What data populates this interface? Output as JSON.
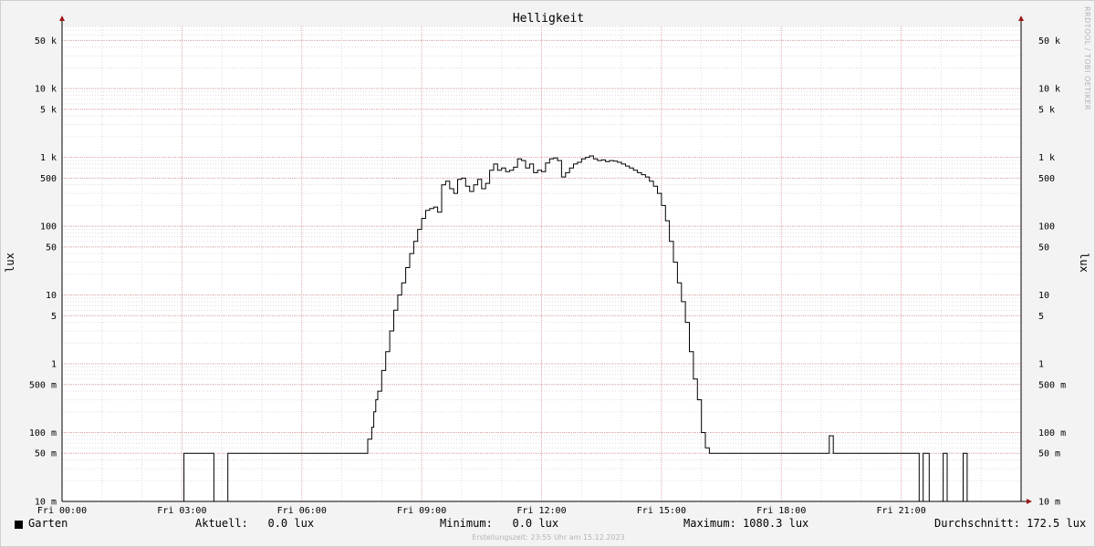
{
  "chart_data": {
    "type": "line",
    "title": "Helligkeit",
    "ylabel": "lux",
    "yscale": "log",
    "ylim": [
      0.01,
      80000
    ],
    "xlim": [
      0,
      24
    ],
    "grid": true,
    "y_ticks": [
      {
        "value": 0.01,
        "label": "10 m"
      },
      {
        "value": 0.05,
        "label": "50 m"
      },
      {
        "value": 0.1,
        "label": "100 m"
      },
      {
        "value": 0.5,
        "label": "500 m"
      },
      {
        "value": 1,
        "label": "1"
      },
      {
        "value": 5,
        "label": "5"
      },
      {
        "value": 10,
        "label": "10"
      },
      {
        "value": 50,
        "label": "50"
      },
      {
        "value": 100,
        "label": "100"
      },
      {
        "value": 500,
        "label": "500"
      },
      {
        "value": 1000,
        "label": "1 k"
      },
      {
        "value": 5000,
        "label": "5 k"
      },
      {
        "value": 10000,
        "label": "10 k"
      },
      {
        "value": 50000,
        "label": "50 k"
      }
    ],
    "x_ticks": [
      {
        "value": 0,
        "label": "Fri 00:00"
      },
      {
        "value": 3,
        "label": "Fri 03:00"
      },
      {
        "value": 6,
        "label": "Fri 06:00"
      },
      {
        "value": 9,
        "label": "Fri 09:00"
      },
      {
        "value": 12,
        "label": "Fri 12:00"
      },
      {
        "value": 15,
        "label": "Fri 15:00"
      },
      {
        "value": 18,
        "label": "Fri 18:00"
      },
      {
        "value": 21,
        "label": "Fri 21:00"
      }
    ],
    "series": [
      {
        "name": "Garten",
        "color": "#000000",
        "x": [
          0,
          3.0,
          3.05,
          3.75,
          3.8,
          4.1,
          4.15,
          4.2,
          7.6,
          7.65,
          7.75,
          7.8,
          7.85,
          7.9,
          8.0,
          8.1,
          8.2,
          8.3,
          8.4,
          8.5,
          8.6,
          8.7,
          8.8,
          8.9,
          9.0,
          9.1,
          9.2,
          9.3,
          9.4,
          9.5,
          9.6,
          9.7,
          9.8,
          9.9,
          10.0,
          10.1,
          10.2,
          10.3,
          10.4,
          10.5,
          10.6,
          10.7,
          10.8,
          10.9,
          11.0,
          11.1,
          11.2,
          11.3,
          11.4,
          11.5,
          11.6,
          11.7,
          11.8,
          11.9,
          12.0,
          12.1,
          12.2,
          12.3,
          12.4,
          12.5,
          12.6,
          12.7,
          12.8,
          12.9,
          13.0,
          13.1,
          13.2,
          13.3,
          13.4,
          13.5,
          13.6,
          13.7,
          13.8,
          13.9,
          14.0,
          14.1,
          14.2,
          14.3,
          14.4,
          14.5,
          14.6,
          14.7,
          14.8,
          14.9,
          15.0,
          15.1,
          15.2,
          15.3,
          15.4,
          15.5,
          15.6,
          15.7,
          15.8,
          15.9,
          16.0,
          16.1,
          16.2,
          16.3,
          16.4,
          16.5,
          16.6,
          16.7,
          16.8,
          16.9,
          17.0,
          17.1,
          17.2,
          17.25,
          19.15,
          19.2,
          19.25,
          19.3,
          21.4,
          21.45,
          21.55,
          21.6,
          21.7,
          21.75,
          22.0,
          22.05,
          22.1,
          22.15,
          22.5,
          22.55,
          22.6,
          22.65,
          24
        ],
        "y": [
          0.01,
          0.01,
          0.05,
          0.05,
          0.01,
          0.01,
          0.05,
          0.05,
          0.05,
          0.08,
          0.12,
          0.2,
          0.3,
          0.4,
          0.8,
          1.5,
          3,
          6,
          10,
          15,
          25,
          40,
          60,
          90,
          130,
          170,
          180,
          190,
          160,
          400,
          450,
          350,
          300,
          480,
          500,
          380,
          320,
          400,
          480,
          350,
          420,
          650,
          800,
          650,
          700,
          620,
          650,
          720,
          950,
          900,
          700,
          800,
          600,
          650,
          620,
          830,
          950,
          980,
          900,
          520,
          600,
          700,
          800,
          850,
          950,
          1000,
          1050,
          950,
          900,
          920,
          870,
          900,
          880,
          850,
          800,
          750,
          700,
          650,
          600,
          560,
          520,
          450,
          380,
          300,
          200,
          120,
          60,
          30,
          15,
          8,
          4,
          1.5,
          0.6,
          0.3,
          0.1,
          0.06,
          0.05,
          0.05,
          0.05,
          0.05,
          0.05,
          0.05,
          0.05,
          0.05,
          0.05,
          0.05,
          0.05,
          0.05,
          0.05,
          0.09,
          0.09,
          0.05,
          0.05,
          0.01,
          0.05,
          0.05,
          0.01,
          0.01,
          0.01,
          0.05,
          0.05,
          0.01,
          0.01,
          0.05,
          0.05,
          0.01,
          0.01
        ]
      }
    ]
  },
  "legend": {
    "series_label": "Garten",
    "current": "Aktuell:   0.0 lux",
    "minimum": "Minimum:   0.0 lux",
    "maximum": "Maximum: 1080.3 lux",
    "average": "Durchschnitt: 172.5 lux"
  },
  "created_text": "Erstellungszeit: 23:55 Uhr am 15.12.2023",
  "watermark": "RRDTOOL / TOBI OETIKER",
  "colors": {
    "background": "#f3f3f3",
    "plot_background": "#ffffff",
    "major_grid": "#e2a8a8",
    "minor_grid": "#dddddd",
    "axis": "#000000",
    "arrow": "#a01818"
  }
}
